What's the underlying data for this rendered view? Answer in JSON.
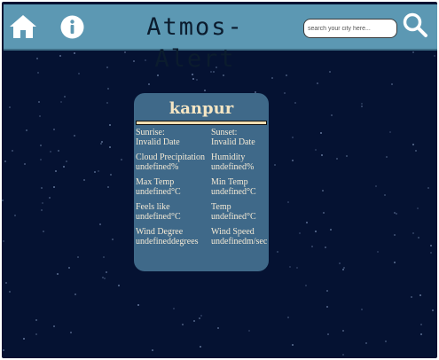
{
  "header": {
    "app_title": "Atmos-Alert",
    "search_placeholder": "search your city here...",
    "icons": {
      "home": "home-icon",
      "info": "info-icon",
      "search": "search-icon"
    }
  },
  "colors": {
    "page_background": "#051232",
    "navbar": "#5c98b3",
    "card": "#3f6989",
    "card_text": "#f4ead6",
    "city_text": "#f5e6c3"
  },
  "weather_card": {
    "city": "kanpur",
    "stats": [
      {
        "label": "Sunrise:",
        "value": "Invalid Date"
      },
      {
        "label": "Sunset:",
        "value": "Invalid Date"
      },
      {
        "label": "Cloud Precipitation",
        "value": "undefined%"
      },
      {
        "label": "Humidity",
        "value": "undefined%"
      },
      {
        "label": "Max Temp",
        "value": "undefined°C"
      },
      {
        "label": "Min Temp",
        "value": "undefined°C"
      },
      {
        "label": "Feels like",
        "value": "undefined°C"
      },
      {
        "label": "Temp",
        "value": "undefined°C"
      },
      {
        "label": "Wind Degree",
        "value": "undefineddegrees"
      },
      {
        "label": "Wind Speed",
        "value": "undefinedm/sec"
      }
    ]
  }
}
